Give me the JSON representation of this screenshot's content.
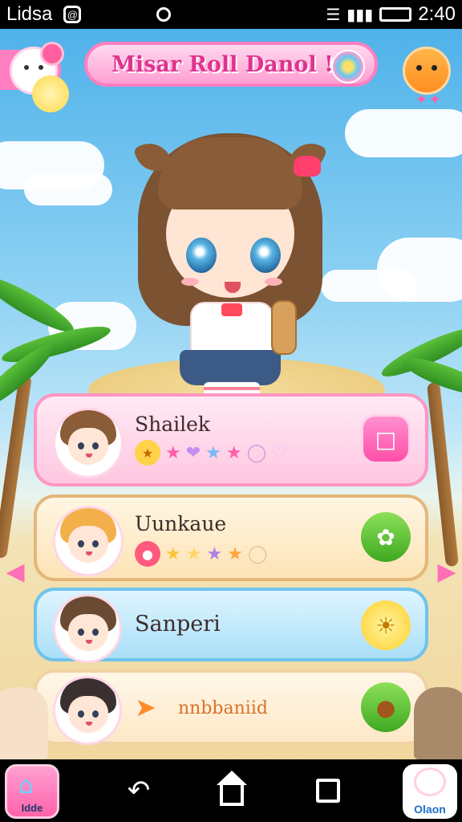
{
  "status_bar": {
    "carrier": "Lidsa",
    "time": "2:40"
  },
  "header": {
    "title": "Misar Roll Danol !"
  },
  "cards": [
    {
      "name": "Shailek",
      "type": "pink",
      "rating": 4
    },
    {
      "name": "Uunkaue",
      "type": "peach",
      "rating": 4
    },
    {
      "name": "Sanperi",
      "type": "blue"
    },
    {
      "name": "nnbbaniid",
      "type": "cream"
    }
  ],
  "nav": {
    "home_app_label": "Idde",
    "clan_app_label": "Olaon"
  },
  "colors": {
    "pink_accent": "#ff7fc0",
    "blue_accent": "#6ec3ec",
    "peach_accent": "#e3b77a",
    "star": "#ff5fa6"
  }
}
